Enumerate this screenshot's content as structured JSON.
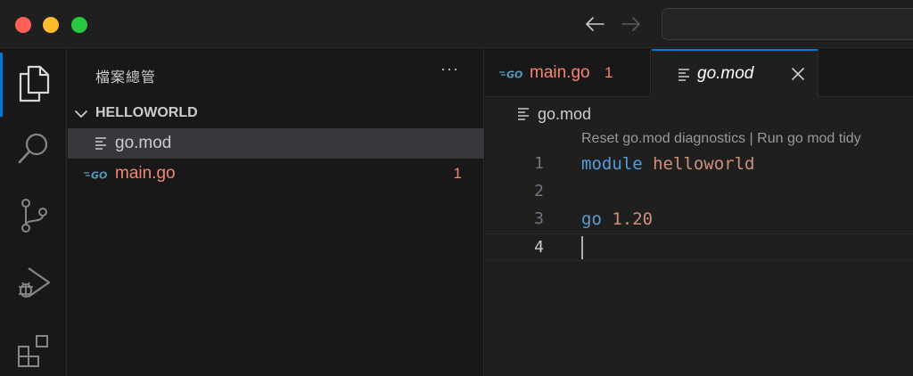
{
  "window": {
    "traffic_colors": {
      "close": "#fe5f57",
      "minimize": "#febc2e",
      "zoom": "#28c840"
    },
    "nav": {
      "back_icon": "arrow-left-icon",
      "forward_icon": "arrow-right-icon"
    }
  },
  "activitybar": {
    "accent": "#0078d4",
    "items": [
      {
        "name": "explorer-icon",
        "active": true
      },
      {
        "name": "search-icon",
        "active": false
      },
      {
        "name": "source-control-icon",
        "active": false
      },
      {
        "name": "run-debug-icon",
        "active": false
      },
      {
        "name": "extensions-icon",
        "active": false
      }
    ]
  },
  "sidebar": {
    "title": "檔案總管",
    "more_label": "···",
    "folder": {
      "name": "HELLOWORLD",
      "expanded": true
    },
    "files": [
      {
        "name": "go.mod",
        "icon": "lines-file-icon",
        "selected": true,
        "badge": ""
      },
      {
        "name": "main.go",
        "icon": "go-file-icon",
        "selected": false,
        "badge": "1"
      }
    ]
  },
  "editor": {
    "tabs": [
      {
        "label": "main.go",
        "icon": "go-file-icon",
        "badge": "1",
        "active": false
      },
      {
        "label": "go.mod",
        "icon": "lines-file-icon",
        "badge": "",
        "active": true,
        "close_icon": "close-icon"
      }
    ],
    "breadcrumb": {
      "icon": "lines-file-icon",
      "label": "go.mod"
    },
    "codelens": "Reset go.mod diagnostics | Run go mod tidy",
    "lines": [
      {
        "number": "1",
        "tokens": [
          {
            "text": "module",
            "kind": "kw"
          },
          {
            "text": " ",
            "kind": "plain"
          },
          {
            "text": "helloworld",
            "kind": "ident"
          }
        ]
      },
      {
        "number": "2",
        "tokens": []
      },
      {
        "number": "3",
        "tokens": [
          {
            "text": "go",
            "kind": "kw"
          },
          {
            "text": " ",
            "kind": "plain"
          },
          {
            "text": "1.20",
            "kind": "ident"
          }
        ]
      },
      {
        "number": "4",
        "tokens": [],
        "current": true
      }
    ],
    "colors": {
      "keyword": "#569cd6",
      "string": "#ce9178",
      "error": "#f48771"
    }
  }
}
